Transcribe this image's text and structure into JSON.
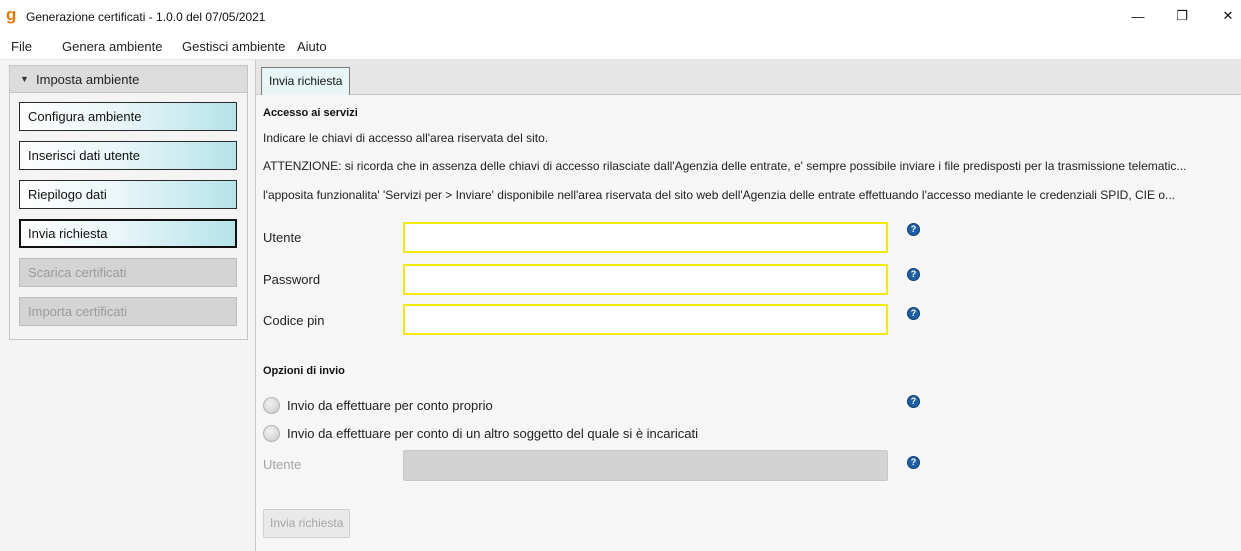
{
  "window": {
    "logo_glyph": "g",
    "title": "Generazione certificati - 1.0.0 del 07/05/2021",
    "minimize_glyph": "—",
    "restore_glyph": "❐",
    "close_glyph": "✕"
  },
  "menu": {
    "items": [
      "File",
      "Genera ambiente",
      "Gestisci ambiente",
      "Aiuto"
    ]
  },
  "sidebar": {
    "header_arrow": "▼",
    "header": "Imposta ambiente",
    "items": [
      {
        "label": "Configura ambiente",
        "state": "enabled"
      },
      {
        "label": "Inserisci dati utente",
        "state": "enabled"
      },
      {
        "label": "Riepilogo dati",
        "state": "enabled"
      },
      {
        "label": "Invia richiesta",
        "state": "selected"
      },
      {
        "label": "Scarica certificati",
        "state": "disabled"
      },
      {
        "label": "Importa certificati",
        "state": "disabled"
      }
    ]
  },
  "main": {
    "tab": "Invia richiesta",
    "access": {
      "title": "Accesso ai servizi",
      "lines": [
        "Indicare le chiavi di accesso all'area riservata del sito.",
        "ATTENZIONE: si ricorda che in assenza delle chiavi di accesso rilasciate dall'Agenzia delle entrate, e' sempre possibile inviare i file predisposti per la trasmissione telematic...",
        "l'apposita funzionalita' 'Servizi per > Inviare' disponibile nell'area riservata del sito web dell'Agenzia delle entrate effettuando l'accesso mediante le credenziali SPID, CIE o..."
      ],
      "fields": [
        {
          "label": "Utente",
          "value": ""
        },
        {
          "label": "Password",
          "value": ""
        },
        {
          "label": "Codice pin",
          "value": ""
        }
      ]
    },
    "options": {
      "title": "Opzioni di invio",
      "radios": [
        {
          "label": "Invio da effettuare per conto proprio",
          "checked": false
        },
        {
          "label": "Invio da effettuare per conto di un altro soggetto del quale si è incaricati",
          "checked": false
        }
      ],
      "delegate_field": {
        "label": "Utente",
        "value": ""
      }
    },
    "submit": "Invia richiesta",
    "help_glyph": "?"
  }
}
